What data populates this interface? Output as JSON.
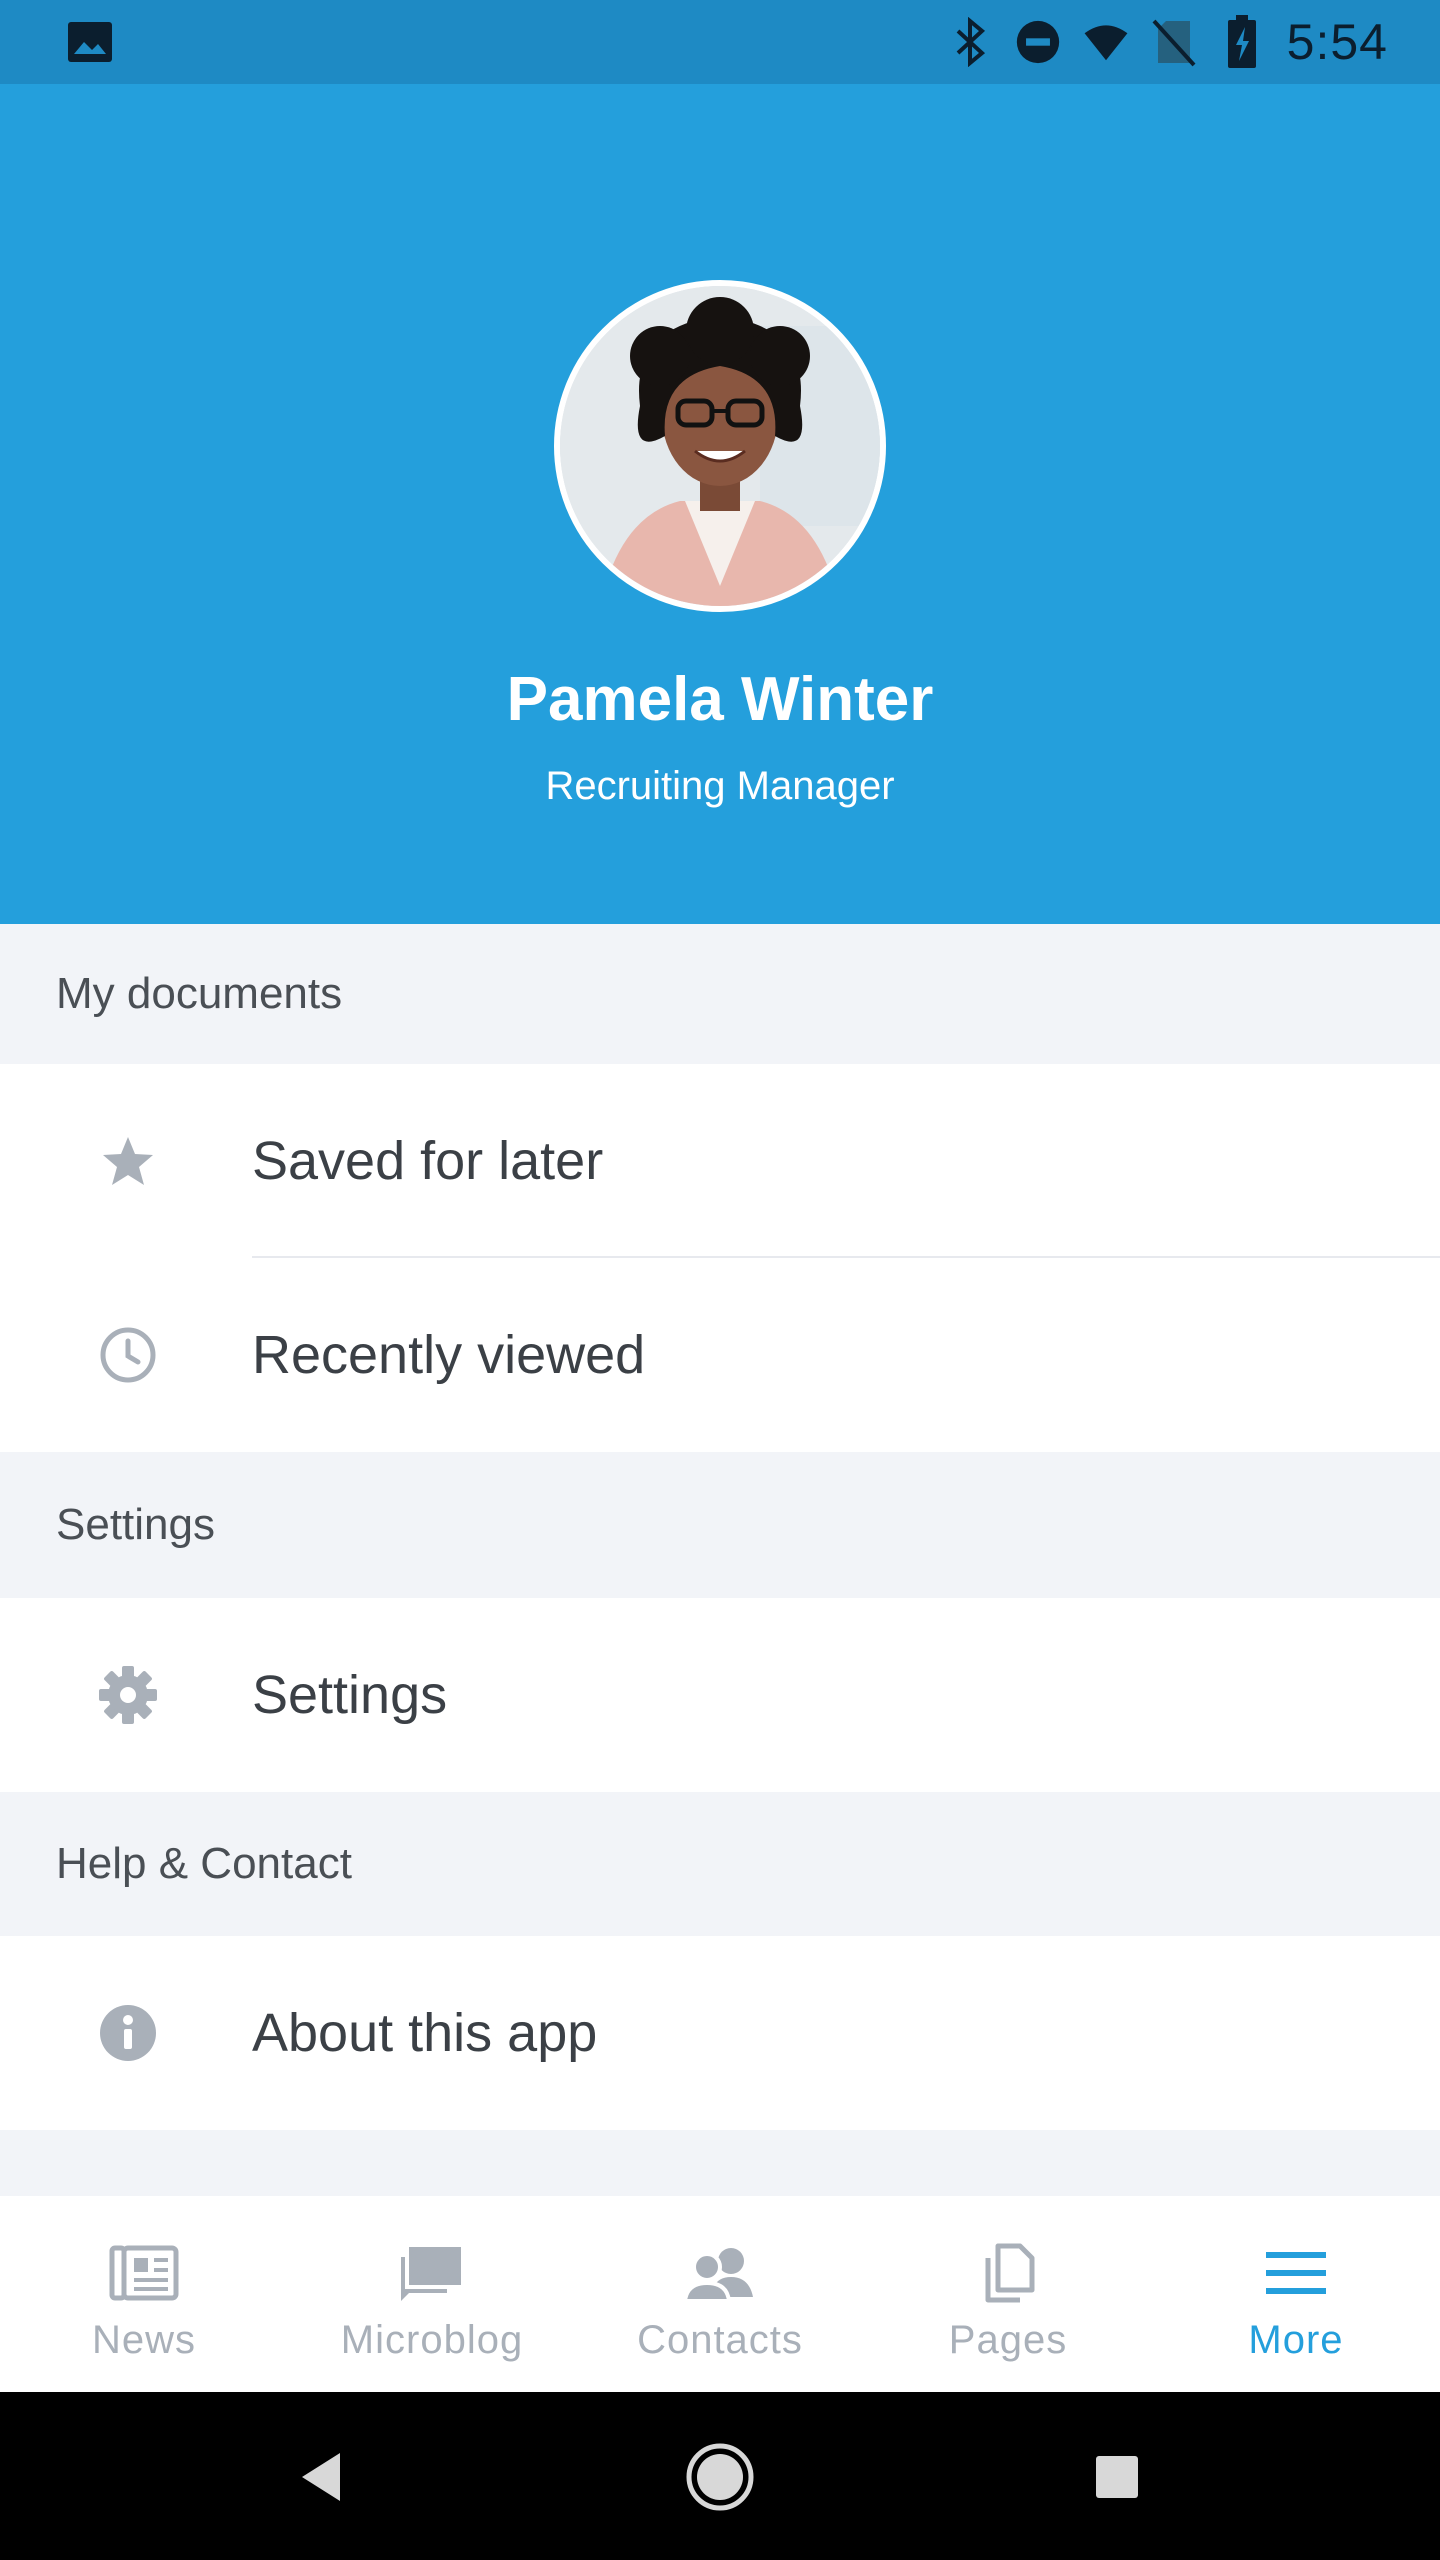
{
  "status_bar": {
    "time": "5:54",
    "icons": [
      "image-icon",
      "bluetooth-icon",
      "do-not-disturb-icon",
      "wifi-icon",
      "no-sim-icon",
      "battery-charging-icon"
    ]
  },
  "profile": {
    "name": "Pamela Winter",
    "role": "Recruiting Manager"
  },
  "sections": {
    "documents": {
      "title": "My documents",
      "items": [
        {
          "label": "Saved for later",
          "icon": "star-icon"
        },
        {
          "label": "Recently viewed",
          "icon": "clock-icon"
        }
      ]
    },
    "settings": {
      "title": "Settings",
      "items": [
        {
          "label": "Settings",
          "icon": "gear-icon"
        }
      ]
    },
    "help": {
      "title": "Help & Contact",
      "items": [
        {
          "label": "About this app",
          "icon": "info-icon"
        }
      ]
    }
  },
  "bottom_nav": {
    "active": "More",
    "items": [
      {
        "label": "News",
        "icon": "newspaper-icon"
      },
      {
        "label": "Microblog",
        "icon": "chat-icon"
      },
      {
        "label": "Contacts",
        "icon": "contacts-icon"
      },
      {
        "label": "Pages",
        "icon": "pages-icon"
      },
      {
        "label": "More",
        "icon": "menu-icon"
      }
    ]
  },
  "colors": {
    "header": "#249fdc",
    "status_bar": "#1e8ac4",
    "accent": "#249fdc",
    "icon_gray": "#a9b0b9",
    "section_bg": "#f2f4f8"
  }
}
